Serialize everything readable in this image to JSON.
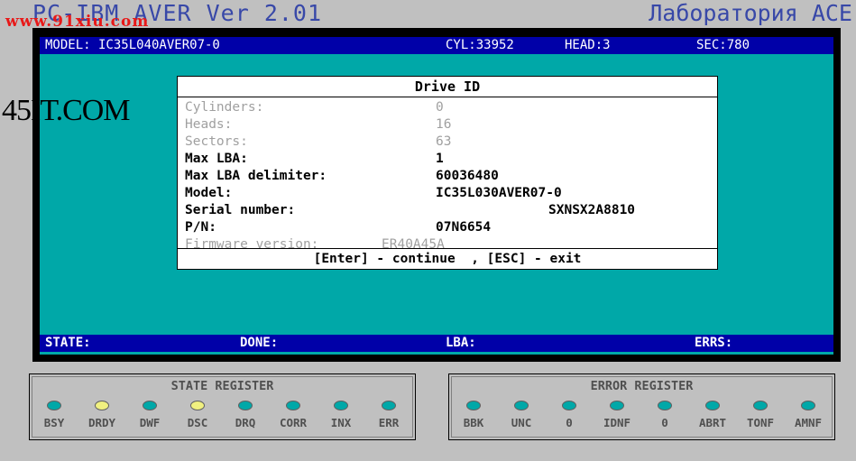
{
  "header": {
    "app_title": "PC-IBM AVER Ver 2.01",
    "lab_title": "Лаборатория ACE",
    "watermark_top": "www.91xiu.com",
    "watermark_side": "45IT.COM"
  },
  "status_top": {
    "model": "MODEL: IC35L040AVER07-0",
    "cyl": "CYL:33952",
    "head": "HEAD:3",
    "sec": "SEC:780"
  },
  "dialog": {
    "title": "Drive ID",
    "rows": [
      {
        "label": "Cylinders:",
        "value": "0"
      },
      {
        "label": "Heads:",
        "value": "16"
      },
      {
        "label": "Sectors:",
        "value": "63"
      },
      {
        "label": "Max LBA:",
        "value": "1"
      },
      {
        "label": "Max LBA delimiter:",
        "value": "60036480"
      },
      {
        "label": "Model:",
        "value": "IC35L030AVER07-0"
      },
      {
        "label": "Serial number:",
        "value": "SXNSX2A8810"
      },
      {
        "label": "P/N:",
        "value": "07N6654"
      },
      {
        "label": "Firmware version:",
        "value": "ER40A45A"
      }
    ],
    "footer": "[Enter] - continue  , [ESC] - exit"
  },
  "status_bottom": {
    "state": "STATE:",
    "done": "DONE:",
    "lba": "LBA:",
    "errs": "ERRS:"
  },
  "state_register": {
    "title": "STATE REGISTER",
    "leds": [
      {
        "label": "BSY",
        "color": "teal"
      },
      {
        "label": "DRDY",
        "color": "yellow"
      },
      {
        "label": "DWF",
        "color": "teal"
      },
      {
        "label": "DSC",
        "color": "yellow"
      },
      {
        "label": "DRQ",
        "color": "teal"
      },
      {
        "label": "CORR",
        "color": "teal"
      },
      {
        "label": "INX",
        "color": "teal"
      },
      {
        "label": "ERR",
        "color": "teal"
      }
    ]
  },
  "error_register": {
    "title": "ERROR REGISTER",
    "leds": [
      {
        "label": "BBK",
        "color": "teal"
      },
      {
        "label": "UNC",
        "color": "teal"
      },
      {
        "label": "0",
        "color": "teal"
      },
      {
        "label": "IDNF",
        "color": "teal"
      },
      {
        "label": "0",
        "color": "teal"
      },
      {
        "label": "ABRT",
        "color": "teal"
      },
      {
        "label": "TONF",
        "color": "teal"
      },
      {
        "label": "AMNF",
        "color": "teal"
      }
    ]
  },
  "colors": {
    "teal": "#00a8a8",
    "yellow": "#f0f080",
    "bar_blue": "#0000a8"
  }
}
